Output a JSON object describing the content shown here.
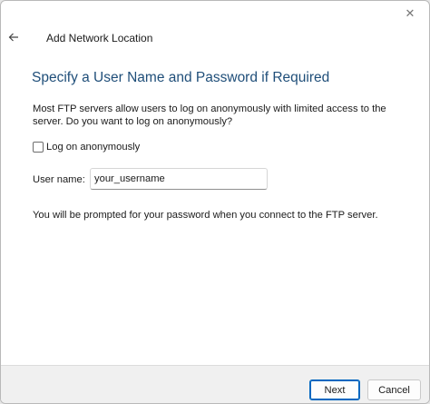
{
  "window": {
    "title": "Add Network Location",
    "close_icon": "close-icon",
    "back_icon": "back-arrow-icon"
  },
  "main": {
    "heading": "Specify a User Name and Password if Required",
    "description": "Most FTP servers allow users to log on anonymously with limited access to the server.  Do you want to log on anonymously?",
    "anonymous_checkbox": {
      "label": "Log on anonymously",
      "checked": false
    },
    "username": {
      "label": "User name:",
      "value": "your_username"
    },
    "note": "You will be prompted for your password when you connect to the FTP server."
  },
  "footer": {
    "next_label": "Next",
    "cancel_label": "Cancel"
  },
  "colors": {
    "heading": "#1f4e79",
    "accent": "#0067c0"
  }
}
